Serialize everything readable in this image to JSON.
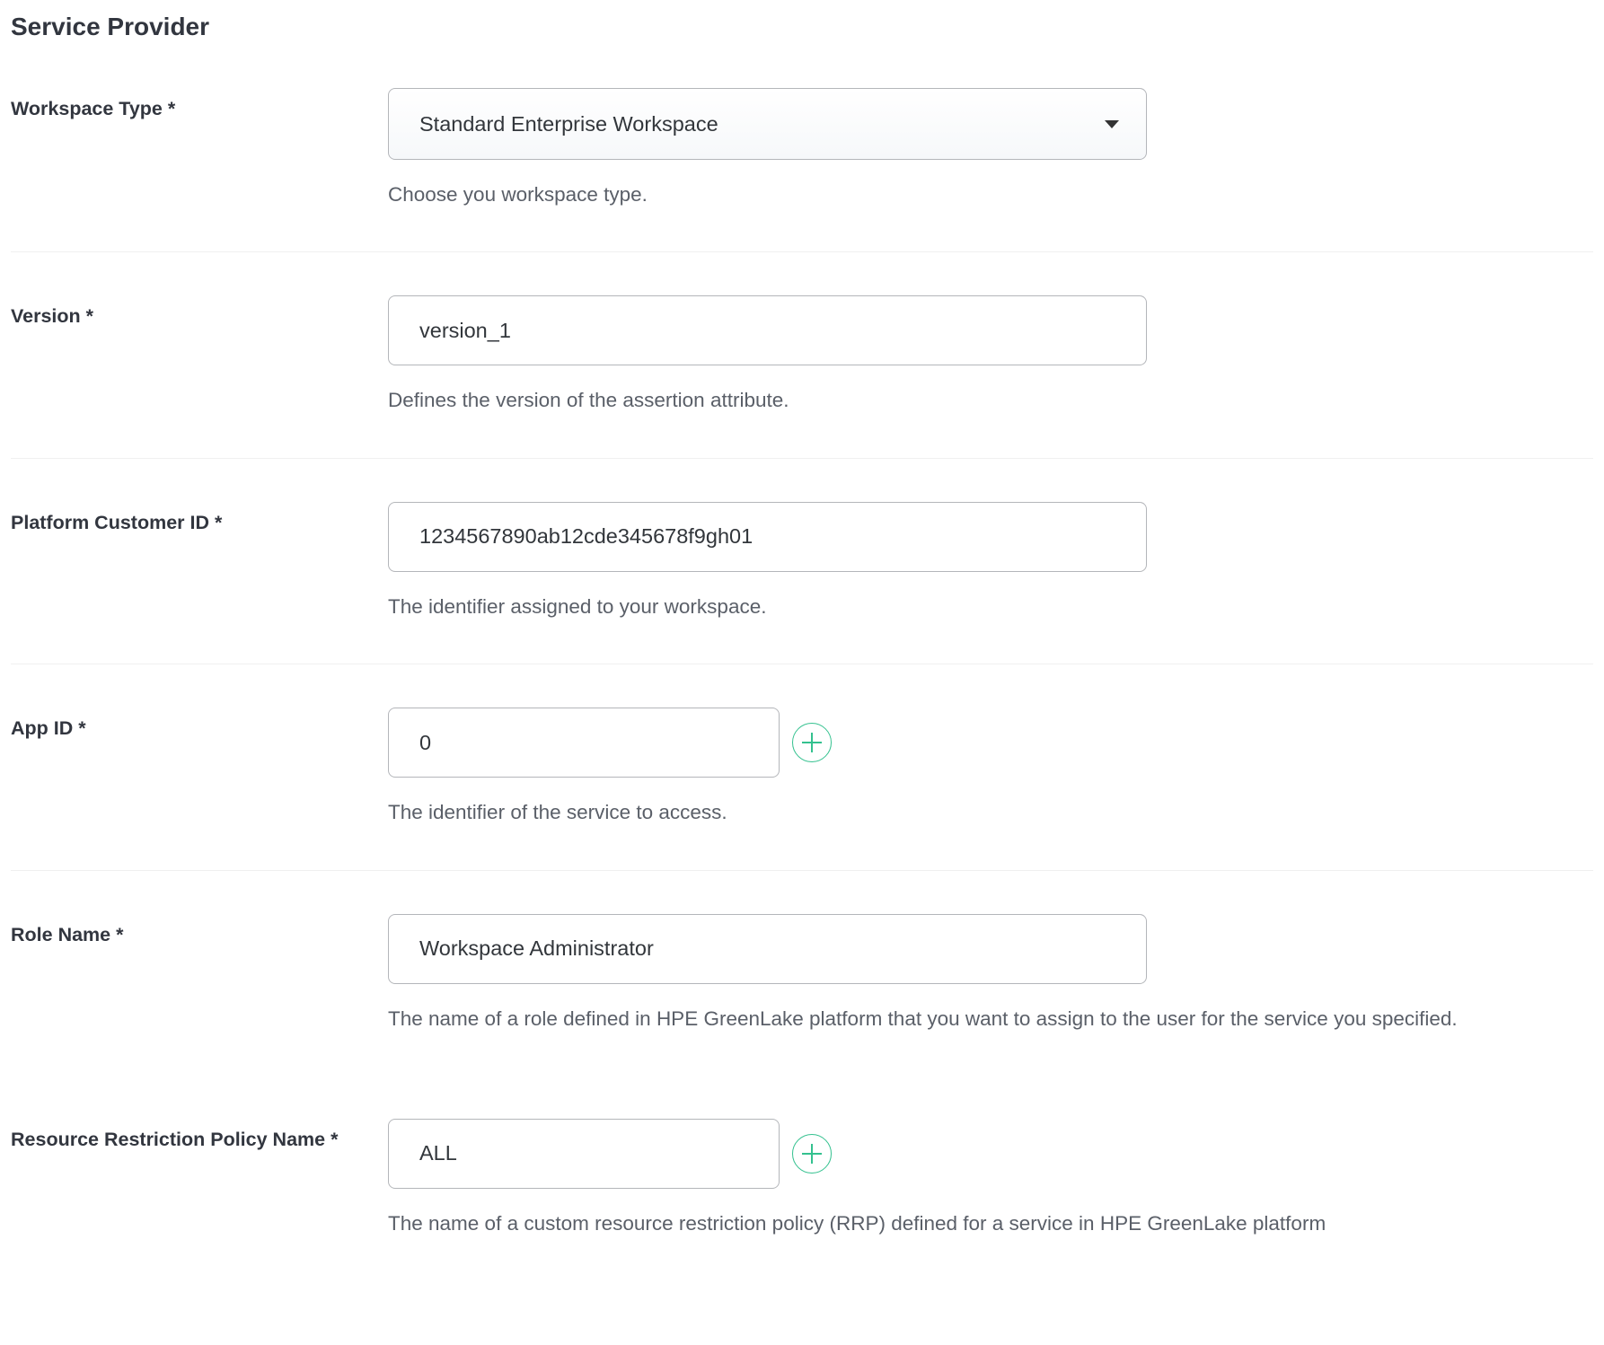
{
  "section_title": "Service Provider",
  "fields": {
    "workspace_type": {
      "label": "Workspace Type  *",
      "value": "Standard Enterprise Workspace",
      "helper": "Choose you workspace type."
    },
    "version": {
      "label": "Version *",
      "value": "version_1",
      "helper": "Defines the version of the assertion attribute."
    },
    "platform_customer_id": {
      "label": "Platform Customer ID *",
      "value": "1234567890ab12cde345678f9gh01",
      "helper": "The identifier assigned to your workspace."
    },
    "app_id": {
      "label": "App ID *",
      "value": "0",
      "helper": "The identifier of the service to access."
    },
    "role_name": {
      "label": "Role Name *",
      "value": "Workspace Administrator",
      "helper": "The name of a role defined in HPE GreenLake platform that you want to assign to the user for the service you specified."
    },
    "rrp_name": {
      "label": "Resource Restriction Policy Name *",
      "value": "ALL",
      "helper": "The name of a custom resource restriction policy (RRP) defined for a service in HPE GreenLake platform"
    }
  }
}
